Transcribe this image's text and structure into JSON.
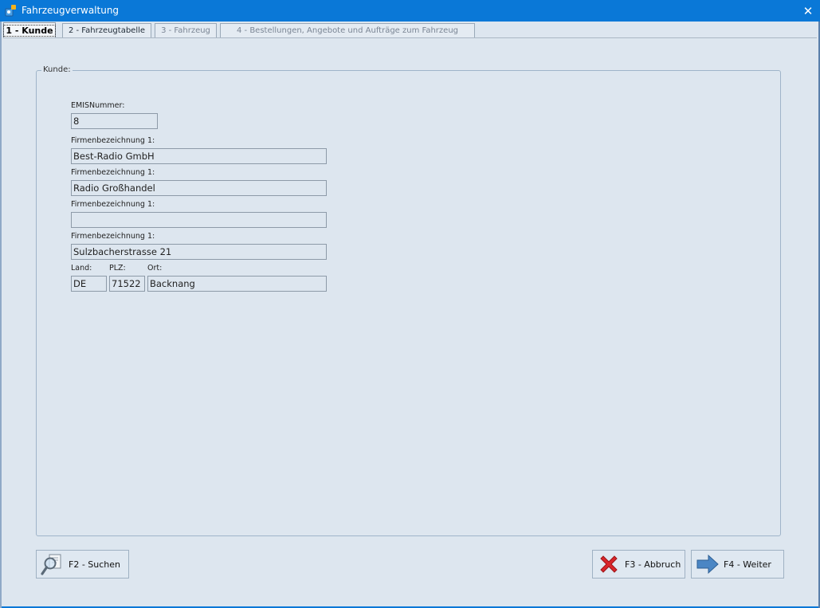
{
  "window": {
    "title": "Fahrzeugverwaltung",
    "close_glyph": "✕"
  },
  "tabs": [
    {
      "label": "1 - Kunde",
      "active": true
    },
    {
      "label": "2 - Fahrzeugtabelle",
      "active": false
    },
    {
      "label": "3 - Fahrzeug",
      "active": false
    },
    {
      "label": "4 - Bestellungen, Angebote und Aufträge zum Fahrzeug",
      "active": false
    }
  ],
  "group": {
    "title": "Kunde:"
  },
  "form": {
    "emis_label": "EMISNummer:",
    "emis_value": "8",
    "firma1_label": "Firmenbezeichnung 1:",
    "firma1_value": "Best-Radio GmbH",
    "firma2_label": "Firmenbezeichnung 1:",
    "firma2_value": "Radio Großhandel",
    "firma3_label": "Firmenbezeichnung 1:",
    "firma3_value": "",
    "firma4_label": "Firmenbezeichnung 1:",
    "firma4_value": "Sulzbacherstrasse 21",
    "land_label": "Land:",
    "land_value": "DE",
    "plz_label": "PLZ:",
    "plz_value": "71522",
    "ort_label": "Ort:",
    "ort_value": "Backnang"
  },
  "buttons": {
    "search": "F2 - Suchen",
    "cancel": "F3 - Abbruch",
    "next": "F4 - Weiter"
  },
  "icons": {
    "search": "magnifier-icon",
    "cancel": "red-x-icon",
    "next": "arrow-right-icon"
  },
  "colors": {
    "titlebar": "#0a78d7",
    "client_bg": "#dde6ef",
    "cancel_red": "#d9262b",
    "arrow_blue": "#4b86c4"
  }
}
